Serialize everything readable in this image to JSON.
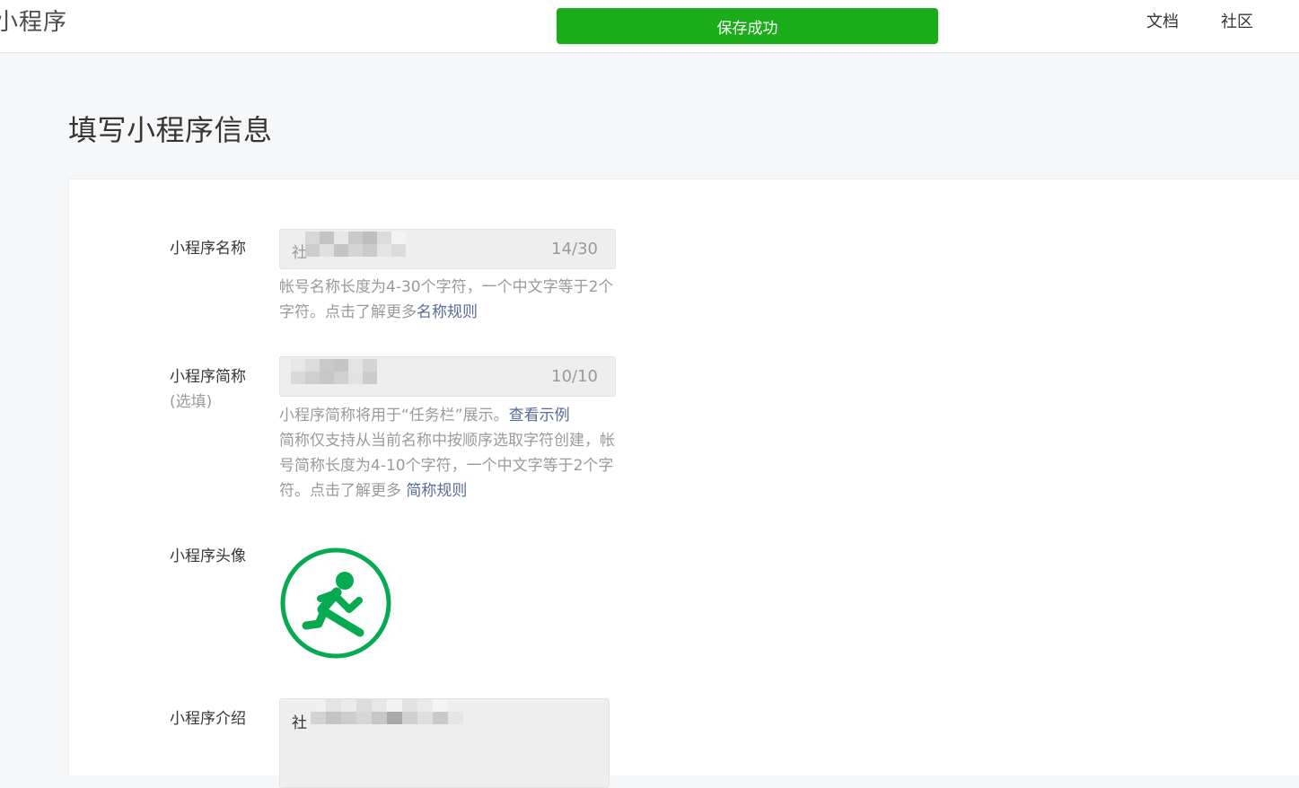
{
  "header": {
    "brand": "小程序",
    "toast": "保存成功",
    "nav": {
      "docs": "文档",
      "community": "社区"
    }
  },
  "page": {
    "title": "填写小程序信息"
  },
  "form": {
    "name": {
      "label": "小程序名称",
      "value": "社",
      "counter": "14/30",
      "hint_text": "帐号名称长度为4-30个字符，一个中文字等于2个字符。点击了解更多",
      "hint_link": "名称规则"
    },
    "short_name": {
      "label": "小程序简称",
      "sub_label": "(选填)",
      "value": "",
      "counter": "10/10",
      "hint_line1": "小程序简称将用于“任务栏”展示。",
      "hint_link1": "查看示例",
      "hint_line2": "简称仅支持从当前名称中按顺序选取字符创建，帐号简称长度为4-10个字符，一个中文字等于2个字符。点击了解更多 ",
      "hint_link2": "简称规则"
    },
    "avatar": {
      "label": "小程序头像",
      "icon": "running-person-icon",
      "color": "#07a951"
    },
    "intro": {
      "label": "小程序介绍",
      "value": "社"
    }
  },
  "colors": {
    "toast_bg": "#1aad19",
    "link": "#576b95",
    "avatar_green": "#07a951"
  }
}
